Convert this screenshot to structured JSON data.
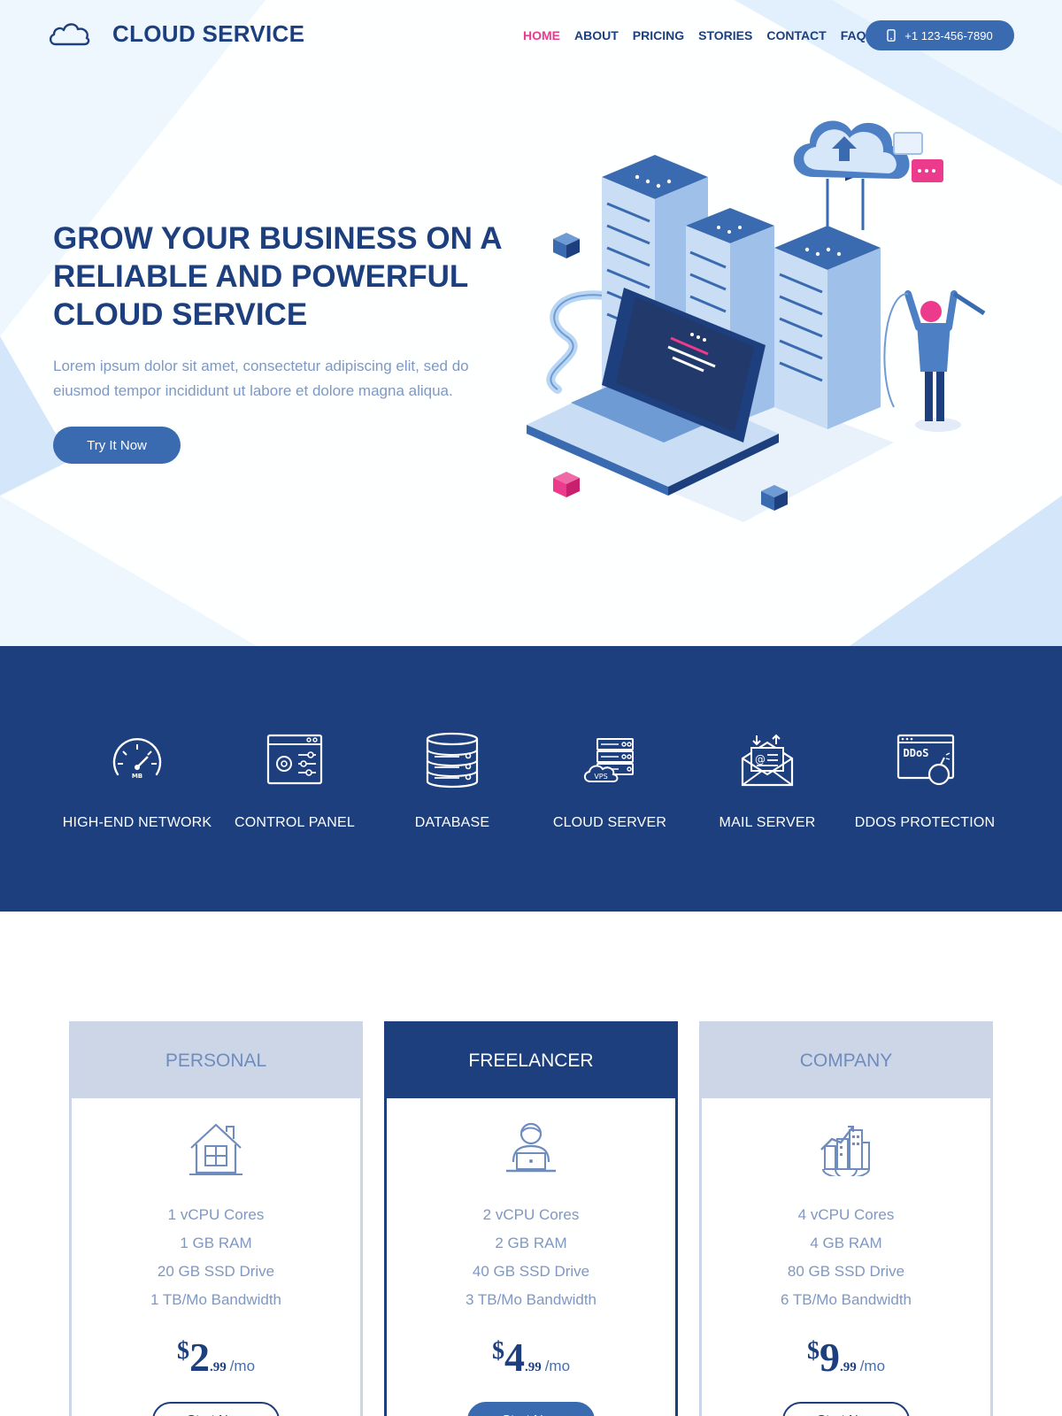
{
  "brand": {
    "name": "CLOUD SERVICE"
  },
  "nav": {
    "items": [
      {
        "label": "HOME",
        "active": true
      },
      {
        "label": "ABOUT"
      },
      {
        "label": "PRICING"
      },
      {
        "label": "STORIES"
      },
      {
        "label": "CONTACT"
      },
      {
        "label": "FAQ"
      }
    ],
    "phone": "+1 123-456-7890"
  },
  "hero": {
    "title_lines": [
      "GROW YOUR BUSINESS ON A",
      "RELIABLE AND POWERFUL",
      "CLOUD SERVICE"
    ],
    "text": "Lorem ipsum dolor sit amet, consectetur adipiscing elit, sed do eiusmod tempor incididunt ut labore et dolore magna aliqua.",
    "cta": "Try It Now"
  },
  "features": [
    {
      "label": "HIGH-END NETWORK",
      "icon": "speedometer-icon",
      "gauge_text": "MB"
    },
    {
      "label": "CONTROL PANEL",
      "icon": "control-panel-icon"
    },
    {
      "label": "DATABASE",
      "icon": "database-icon"
    },
    {
      "label": "CLOUD SERVER",
      "icon": "cloud-server-icon",
      "icon_text": "VPS"
    },
    {
      "label": "MAIL SERVER",
      "icon": "mail-server-icon",
      "icon_text": "@"
    },
    {
      "label": "DDOS PROTECTION",
      "icon": "ddos-icon",
      "icon_text": "DDoS"
    }
  ],
  "plans": [
    {
      "name": "PERSONAL",
      "icon": "house-icon",
      "features": [
        "1 vCPU Cores",
        "1 GB RAM",
        "20 GB SSD Drive",
        "1 TB/Mo Bandwidth"
      ],
      "currency": "$",
      "price_int": "2",
      "price_dec": ".99",
      "period": "/mo",
      "button": "Start Now"
    },
    {
      "name": "FREELANCER",
      "icon": "freelancer-icon",
      "featured": true,
      "features": [
        "2 vCPU Cores",
        "2 GB RAM",
        "40 GB SSD Drive",
        "3 TB/Mo Bandwidth"
      ],
      "currency": "$",
      "price_int": "4",
      "price_dec": ".99",
      "period": "/mo",
      "button": "Start Now"
    },
    {
      "name": "COMPANY",
      "icon": "company-icon",
      "features": [
        "4 vCPU Cores",
        "4 GB RAM",
        "80 GB SSD Drive",
        "6 TB/Mo Bandwidth"
      ],
      "currency": "$",
      "price_int": "9",
      "price_dec": ".99",
      "period": "/mo",
      "button": "Start Now"
    }
  ],
  "colors": {
    "primary": "#1d3f7e",
    "accent": "#ec3a8c",
    "button": "#3a6ab0",
    "muted_text": "#7f98c2",
    "hero_bg": "#eef6fe"
  }
}
